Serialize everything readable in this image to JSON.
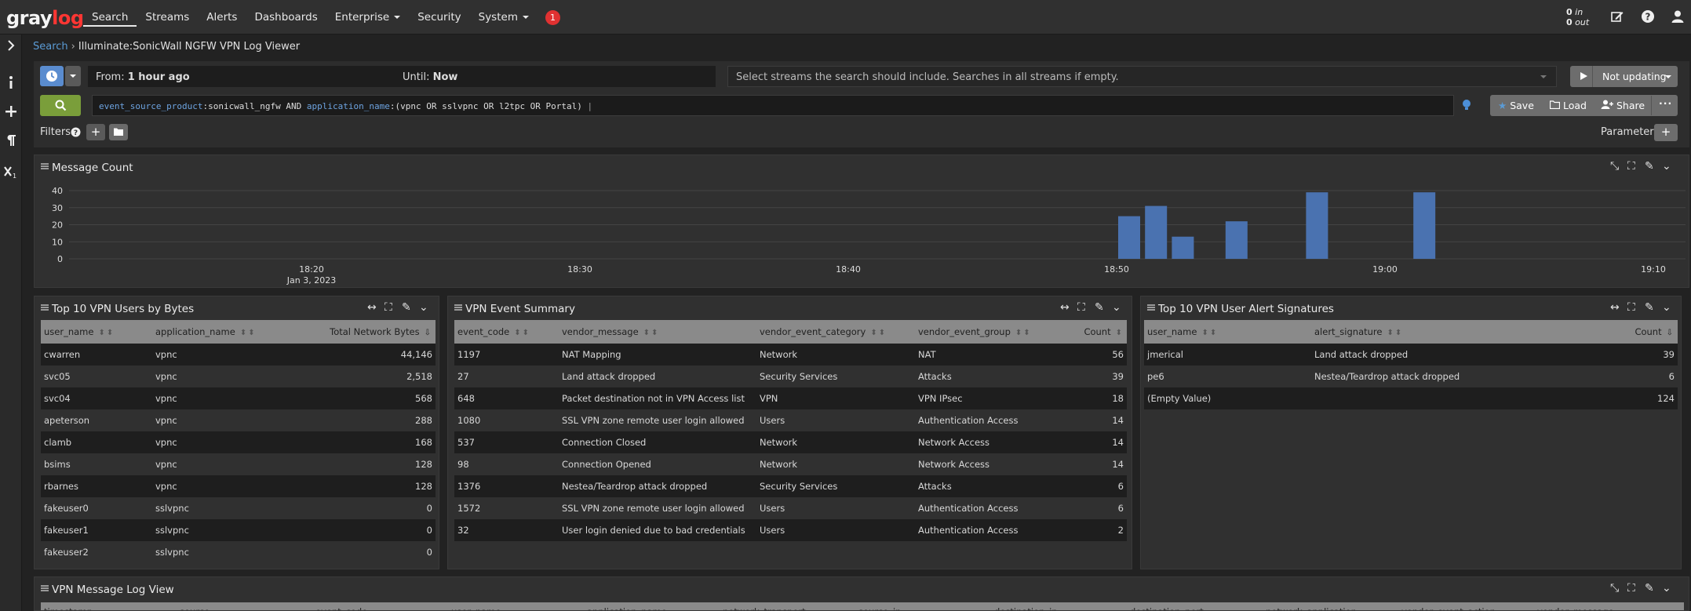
{
  "nav": {
    "logo_a": "gray",
    "logo_b": "log",
    "items": [
      "Search",
      "Streams",
      "Alerts",
      "Dashboards",
      "Enterprise",
      "Security",
      "System"
    ],
    "notification_count": "1",
    "throughput_in": "0",
    "throughput_in_label": "in",
    "throughput_out": "0",
    "throughput_out_label": "out"
  },
  "breadcrumb": {
    "root": "Search",
    "sep": "›",
    "current": "Illuminate:SonicWall NGFW VPN Log Viewer"
  },
  "timerange": {
    "from_label": "From:",
    "from_value": "1 hour ago",
    "until_label": "Until:",
    "until_value": "Now"
  },
  "streams_placeholder": "Select streams the search should include. Searches in all streams if empty.",
  "refresh_label": "Not updating",
  "query": {
    "k1": "event_source_product",
    "v1": ":sonicwall_ngfw AND ",
    "k2": "application_name",
    "v2": ":(vpnc OR sslvpnc OR l2tpc OR Portal)"
  },
  "actions": {
    "save": "Save",
    "load": "Load",
    "share": "Share"
  },
  "filters_label": "Filters",
  "parameters_label": "Parameters",
  "message_count": {
    "title": "Message Count",
    "chart_data": {
      "type": "bar",
      "y_ticks": [
        "40",
        "30",
        "20",
        "10",
        "0"
      ],
      "ylim": [
        0,
        40
      ],
      "x_ticks": [
        "18:20",
        "18:30",
        "18:40",
        "18:50",
        "19:00",
        "19:10"
      ],
      "x_subtick": "Jan 3, 2023",
      "series": [
        {
          "values": [
            {
              "t": "18:50",
              "v": 25
            },
            {
              "t": "18:51",
              "v": 31
            },
            {
              "t": "18:52",
              "v": 13
            },
            {
              "t": "18:54",
              "v": 22
            },
            {
              "t": "18:57",
              "v": 39
            },
            {
              "t": "19:01",
              "v": 39
            }
          ]
        }
      ],
      "color": "#4a72b0"
    }
  },
  "top_users": {
    "title": "Top 10 VPN Users by Bytes",
    "headers": [
      "user_name",
      "application_name",
      "Total Network Bytes"
    ],
    "rows": [
      [
        "cwarren",
        "vpnc",
        "44,146"
      ],
      [
        "svc05",
        "vpnc",
        "2,518"
      ],
      [
        "svc04",
        "vpnc",
        "568"
      ],
      [
        "apeterson",
        "vpnc",
        "288"
      ],
      [
        "clamb",
        "vpnc",
        "168"
      ],
      [
        "bsims",
        "vpnc",
        "128"
      ],
      [
        "rbarnes",
        "vpnc",
        "128"
      ],
      [
        "fakeuser0",
        "sslvpnc",
        "0"
      ],
      [
        "fakeuser1",
        "sslvpnc",
        "0"
      ],
      [
        "fakeuser2",
        "sslvpnc",
        "0"
      ]
    ]
  },
  "event_summary": {
    "title": "VPN Event Summary",
    "headers": [
      "event_code",
      "vendor_message",
      "vendor_event_category",
      "vendor_event_group",
      "Count"
    ],
    "rows": [
      [
        "1197",
        "NAT Mapping",
        "Network",
        "NAT",
        "56"
      ],
      [
        "27",
        "Land attack dropped",
        "Security Services",
        "Attacks",
        "39"
      ],
      [
        "648",
        "Packet destination not in VPN Access list",
        "VPN",
        "VPN IPsec",
        "18"
      ],
      [
        "1080",
        "SSL VPN zone remote user login allowed",
        "Users",
        "Authentication Access",
        "14"
      ],
      [
        "537",
        "Connection Closed",
        "Network",
        "Network Access",
        "14"
      ],
      [
        "98",
        "Connection Opened",
        "Network",
        "Network Access",
        "14"
      ],
      [
        "1376",
        "Nestea/Teardrop attack dropped",
        "Security Services",
        "Attacks",
        "6"
      ],
      [
        "1572",
        "SSL VPN zone remote user login allowed",
        "Users",
        "Authentication Access",
        "6"
      ],
      [
        "32",
        "User login denied due to bad credentials",
        "Users",
        "Authentication Access",
        "2"
      ]
    ]
  },
  "alert_sigs": {
    "title": "Top 10 VPN User Alert Signatures",
    "headers": [
      "user_name",
      "alert_signature",
      "Count"
    ],
    "rows": [
      [
        "jmerical",
        "Land attack dropped",
        "39"
      ],
      [
        "pe6",
        "Nestea/Teardrop attack dropped",
        "6"
      ],
      [
        "(Empty Value)",
        "",
        "124"
      ]
    ]
  },
  "message_log": {
    "title": "VPN Message Log View",
    "headers": [
      "timestamp",
      "source",
      "event_code",
      "user_name",
      "application_name",
      "network_transport",
      "source_ip",
      "destination_ip",
      "destination_port",
      "network_application",
      "vendor_event_action",
      "vendor_message"
    ]
  }
}
